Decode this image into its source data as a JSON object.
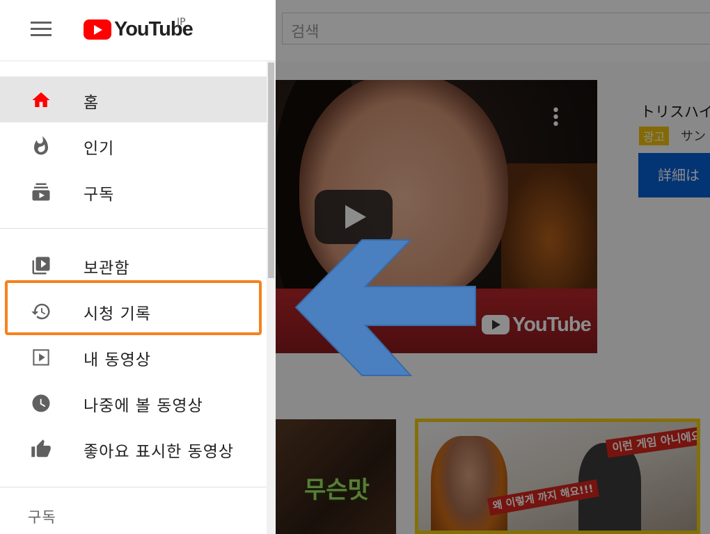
{
  "brand": {
    "logo_text": "YouTube",
    "region": "JP"
  },
  "search": {
    "placeholder": "검색"
  },
  "drawer": {
    "primary": [
      {
        "label": "홈",
        "icon": "home-icon",
        "active": true
      },
      {
        "label": "인기",
        "icon": "trending-flame-icon"
      },
      {
        "label": "구독",
        "icon": "subscriptions-icon"
      }
    ],
    "library": [
      {
        "label": "보관함",
        "icon": "library-icon"
      },
      {
        "label": "시청 기록",
        "icon": "history-icon"
      },
      {
        "label": "내 동영상",
        "icon": "my-videos-icon"
      },
      {
        "label": "나중에 볼 동영상",
        "icon": "watch-later-clock-icon"
      },
      {
        "label": "좋아요 표시한 동영상",
        "icon": "thumbs-up-icon"
      }
    ],
    "subscriptions_header": "구독"
  },
  "ad": {
    "title": "トリスハイ",
    "badge": "광고",
    "sponsor": "サン",
    "cta_label": "詳細は"
  },
  "player": {
    "watermark_text": "YouTube"
  },
  "thumbnails": [
    {
      "caption": "무슨맛"
    },
    {
      "caption_top": "이런 게임 아니에요!!!",
      "caption_bottom": "왜 이렇게 까지 해요!!!"
    }
  ],
  "colors": {
    "brand_red": "#ff0000",
    "accent_orange": "#f5821f",
    "arrow_blue": "#4a7fc0",
    "cta_blue": "#065fd4",
    "ad_badge": "#f0c10e"
  }
}
